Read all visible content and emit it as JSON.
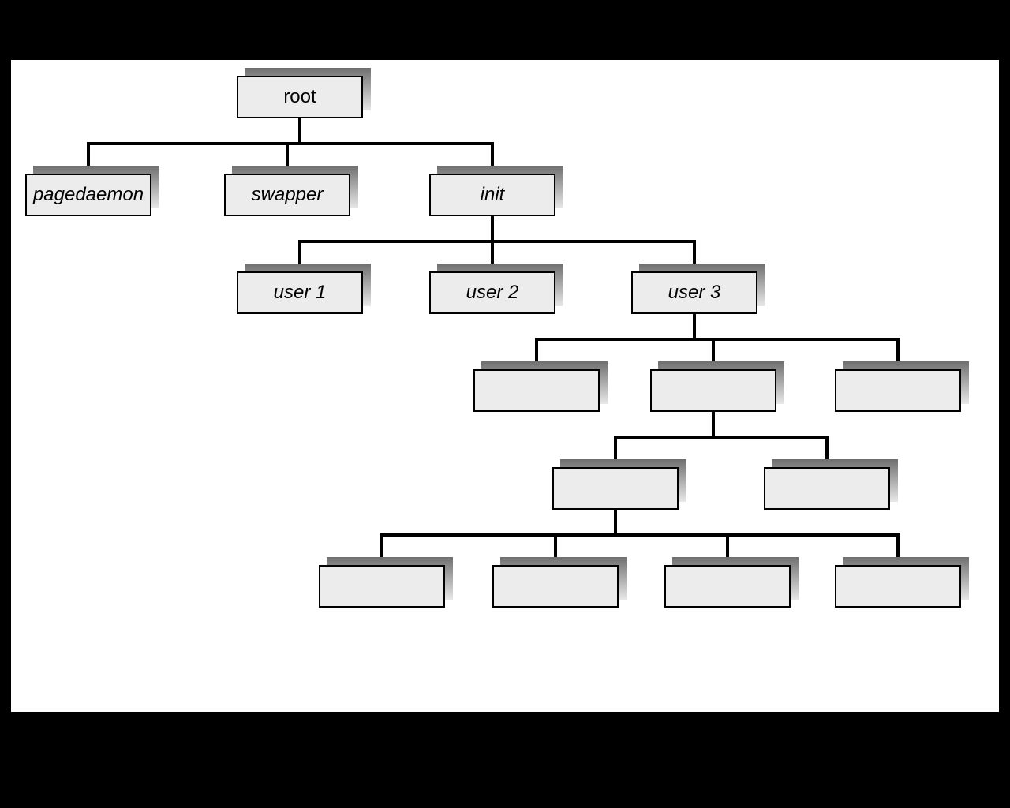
{
  "nodes": {
    "root": {
      "label": "root",
      "italic": false
    },
    "pagedaemon": {
      "label": "pagedaemon",
      "italic": true
    },
    "swapper": {
      "label": "swapper",
      "italic": true
    },
    "init": {
      "label": "init",
      "italic": true
    },
    "user1": {
      "label": "user 1",
      "italic": true
    },
    "user2": {
      "label": "user 2",
      "italic": true
    },
    "user3": {
      "label": "user 3",
      "italic": true
    },
    "l3a": {
      "label": "",
      "italic": false
    },
    "l3b": {
      "label": "",
      "italic": false
    },
    "l3c": {
      "label": "",
      "italic": false
    },
    "l4a": {
      "label": "",
      "italic": false
    },
    "l4b": {
      "label": "",
      "italic": false
    },
    "l5a": {
      "label": "",
      "italic": false
    },
    "l5b": {
      "label": "",
      "italic": false
    },
    "l5c": {
      "label": "",
      "italic": false
    },
    "l5d": {
      "label": "",
      "italic": false
    }
  },
  "chart_data": {
    "type": "tree",
    "root": "root",
    "edges": [
      [
        "root",
        "pagedaemon"
      ],
      [
        "root",
        "swapper"
      ],
      [
        "root",
        "init"
      ],
      [
        "init",
        "user1"
      ],
      [
        "init",
        "user2"
      ],
      [
        "init",
        "user3"
      ],
      [
        "user3",
        "l3a"
      ],
      [
        "user3",
        "l3b"
      ],
      [
        "user3",
        "l3c"
      ],
      [
        "l3b",
        "l4a"
      ],
      [
        "l3b",
        "l4b"
      ],
      [
        "l4a",
        "l5a"
      ],
      [
        "l4a",
        "l5b"
      ],
      [
        "l4a",
        "l5c"
      ],
      [
        "l4a",
        "l5d"
      ]
    ]
  }
}
